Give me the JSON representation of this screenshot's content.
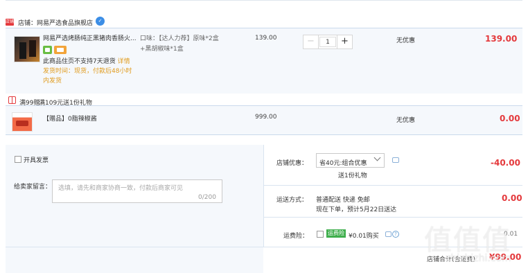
{
  "shop": {
    "badge": "店铺",
    "name": "店铺：网易严选食品旗舰店",
    "chat_icon": "chat-icon"
  },
  "item": {
    "title": "网易严选烤肠纯正黑猪肉香肠火...",
    "notice": "此商品住页不支持7天退货",
    "detail_link": "详情",
    "ship_note": "发货时间：现货，付款后48小时内发货",
    "attributes": "口味：【达人力荐】原味*2盒+黑胡椒味*1盒",
    "price": "139.00",
    "quantity": "1",
    "minus": "−",
    "plus": "+",
    "discount": "无优惠",
    "total": "139.00"
  },
  "promotion": {
    "tag": "满99赠",
    "text": "满109元送1份礼物"
  },
  "gift": {
    "title": "【赠品】0脂辣椒酱",
    "price": "999.00",
    "discount": "无优惠",
    "total": "0.00"
  },
  "invoice": {
    "label": "开具发票"
  },
  "message": {
    "label": "给卖家留言：",
    "placeholder": "选填，请先和商家协商一致，付款后商家可见",
    "count": "0/200"
  },
  "shop_discount": {
    "label": "店铺优惠：",
    "selected": "省40元:组合优惠",
    "gift_note": "送1份礼物",
    "amount": "-40.00"
  },
  "shipping": {
    "label": "运送方式：",
    "method": "普通配送 快递 免邮",
    "time": "现在下单，预计5月22日送达",
    "amount": "0.00"
  },
  "insurance": {
    "label": "运费险：",
    "tag": "运费险",
    "text": "¥0.01购买",
    "amount": "0.01"
  },
  "summary": {
    "label": "店铺合计(含运费)",
    "total": "¥99.00"
  },
  "watermark": {
    "logo": "值值值",
    "site": "zhizhizhi.com"
  },
  "colors": {
    "accent": "#e4393c",
    "light_bg": "#f5f8fc",
    "warning": "#e09b1d",
    "insurance": "#3eae4c"
  }
}
